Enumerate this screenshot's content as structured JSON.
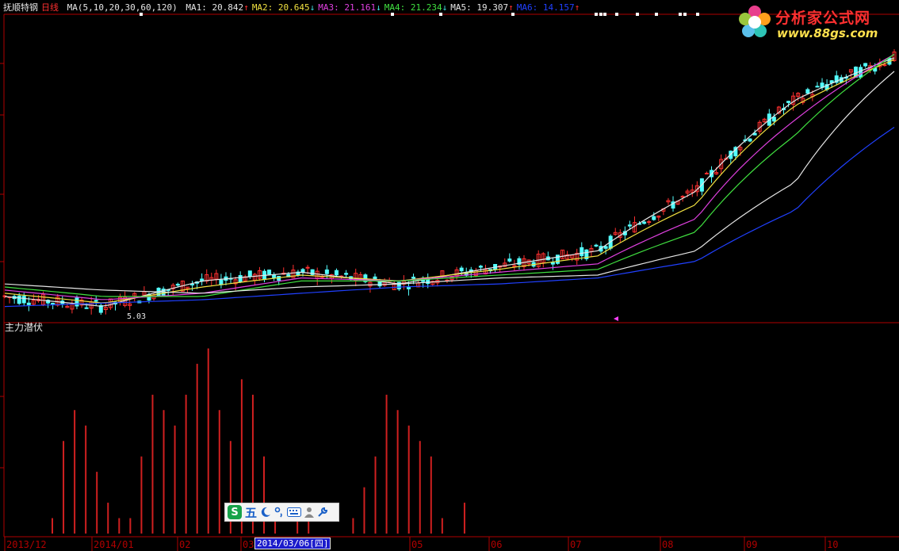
{
  "header": {
    "stock_name": "抚顺特钢",
    "period": "日线",
    "ma_params": "MA(5,10,20,30,60,120)",
    "ma_values": [
      {
        "label": "MA1: 20.842",
        "arrow": "↑",
        "color": "#e6e6e6"
      },
      {
        "label": "MA2: 20.645",
        "arrow": "↓",
        "color": "#f0e040"
      },
      {
        "label": "MA3: 21.161",
        "arrow": "↓",
        "color": "#e040e0"
      },
      {
        "label": "MA4: 21.234",
        "arrow": "↓",
        "color": "#40e040"
      },
      {
        "label": "MA5: 19.307",
        "arrow": "↑",
        "color": "#e6e6e6"
      },
      {
        "label": "MA6: 14.157",
        "arrow": "↑",
        "color": "#2040ff"
      }
    ]
  },
  "logo": {
    "brand": "分析家公式网",
    "url": "www.88gs.com"
  },
  "price_panel": {
    "min_label": "5.03"
  },
  "indicator_panel": {
    "title": "主力潜伏"
  },
  "ime_toolbar": {
    "brand_icon": "S",
    "mode_label": "五"
  },
  "timeline": {
    "labels": [
      "2013/12",
      "2014/01",
      "02",
      "03",
      "05",
      "06",
      "07",
      "08",
      "09",
      "10"
    ],
    "cursor_date": "2014/03/06[四]"
  },
  "colors": {
    "background": "#000000",
    "frame": "#b00000",
    "up_candle": "#ff3030",
    "down_candle": "#54ffff",
    "indicator_bar": "#d02020",
    "marker": "#ff40ff"
  },
  "chart_data": [
    {
      "type": "line",
      "title": "抚顺特钢 日线",
      "x": [
        "2013/12",
        "2014/01",
        "02",
        "03",
        "05",
        "06",
        "07",
        "08",
        "09",
        "10"
      ],
      "series": [
        {
          "name": "MA1",
          "values": [
            5.6,
            5.3,
            6.1,
            6.4,
            6.0,
            6.6,
            7.2,
            10.0,
            16.5,
            20.8
          ]
        },
        {
          "name": "MA2",
          "values": [
            5.7,
            5.4,
            5.9,
            6.3,
            6.1,
            6.5,
            7.0,
            9.3,
            16.0,
            20.6
          ]
        },
        {
          "name": "MA3",
          "values": [
            5.8,
            5.5,
            5.7,
            6.2,
            6.1,
            6.4,
            6.7,
            8.6,
            14.8,
            21.2
          ]
        },
        {
          "name": "MA4",
          "values": [
            5.9,
            5.6,
            5.6,
            6.1,
            6.1,
            6.3,
            6.5,
            8.0,
            13.6,
            21.2
          ]
        },
        {
          "name": "MA5",
          "values": [
            6.0,
            5.8,
            5.7,
            5.9,
            6.0,
            6.2,
            6.3,
            7.2,
            10.5,
            19.3
          ]
        },
        {
          "name": "MA6",
          "values": [
            5.3,
            5.4,
            5.5,
            5.7,
            5.9,
            6.0,
            6.2,
            6.8,
            9.0,
            14.2
          ]
        }
      ],
      "annotations": [
        "5.03"
      ]
    },
    {
      "type": "bar",
      "title": "主力潜伏",
      "values": [
        1,
        6,
        8,
        7,
        4,
        2,
        1,
        1,
        5,
        9,
        8,
        7,
        9,
        11,
        12,
        8,
        6,
        10,
        9,
        5,
        1,
        0,
        1,
        2,
        0,
        0,
        0,
        1,
        3,
        5,
        9,
        8,
        7,
        6,
        5,
        1,
        0,
        2,
        0
      ],
      "ylim": [
        0,
        13
      ]
    }
  ]
}
